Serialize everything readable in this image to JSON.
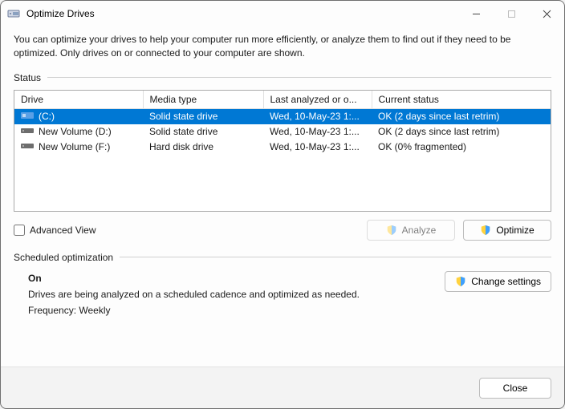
{
  "window": {
    "title": "Optimize Drives"
  },
  "description": "You can optimize your drives to help your computer run more efficiently, or analyze them to find out if they need to be optimized. Only drives on or connected to your computer are shown.",
  "status_label": "Status",
  "columns": {
    "drive": "Drive",
    "media": "Media type",
    "last": "Last analyzed or o...",
    "status": "Current status"
  },
  "drives": [
    {
      "name": "(C:)",
      "media": "Solid state drive",
      "last": "Wed, 10-May-23 1:...",
      "status": "OK (2 days since last retrim)",
      "selected": true,
      "icon": "system"
    },
    {
      "name": "New Volume (D:)",
      "media": "Solid state drive",
      "last": "Wed, 10-May-23 1:...",
      "status": "OK (2 days since last retrim)",
      "selected": false,
      "icon": "hdd"
    },
    {
      "name": "New Volume (F:)",
      "media": "Hard disk drive",
      "last": "Wed, 10-May-23 1:...",
      "status": "OK (0% fragmented)",
      "selected": false,
      "icon": "hdd"
    }
  ],
  "advanced_view": {
    "label": "Advanced View",
    "checked": false
  },
  "buttons": {
    "analyze": "Analyze",
    "optimize": "Optimize",
    "change_settings": "Change settings",
    "close": "Close"
  },
  "scheduled": {
    "section_label": "Scheduled optimization",
    "status": "On",
    "desc": "Drives are being analyzed on a scheduled cadence and optimized as needed.",
    "frequency": "Frequency: Weekly"
  }
}
